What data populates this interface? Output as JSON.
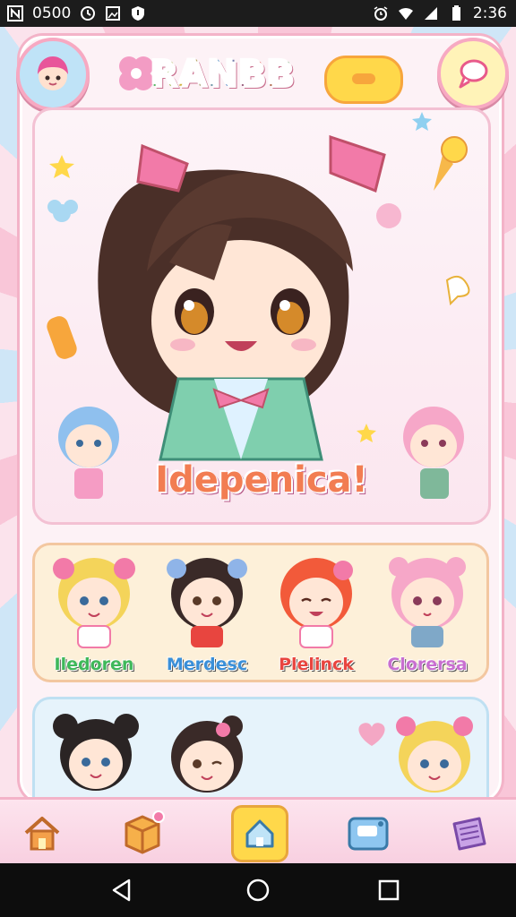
{
  "status_bar": {
    "left_text": "0500",
    "time": "2:36",
    "icons": [
      "notification-n-icon",
      "clock-icon",
      "image-icon",
      "shield-icon",
      "alarm-icon",
      "wifi-icon",
      "signal-icon",
      "battery-icon"
    ]
  },
  "header": {
    "logo_text": "RANBB",
    "avatar_icon": "girl-avatar-icon",
    "chat_icon": "chat-bubble-icon"
  },
  "hero": {
    "title": "Idepenica!",
    "main_character": "girl-brown-hair-pink-bows",
    "side_characters": [
      "chibi-blue-hair",
      "chibi-pink-hair"
    ]
  },
  "characters_row1": [
    {
      "name": "Iledoren",
      "color": "#3fb85a",
      "hair": "#f4d45a"
    },
    {
      "name": "Merdesc",
      "color": "#3a8fd8",
      "hair": "#3a2a28"
    },
    {
      "name": "Plelinck",
      "color": "#e8453f",
      "hair": "#f25a3a"
    },
    {
      "name": "Clorersa",
      "color": "#c86fd0",
      "hair": "#f6a7c8"
    }
  ],
  "characters_row2": [
    {
      "hair": "#2a2424"
    },
    {
      "hair": "#3a2a28"
    },
    {
      "hair": "#f4d45a"
    }
  ],
  "bottom_nav": [
    {
      "icon": "home-icon",
      "color": "#e8944a"
    },
    {
      "icon": "gift-box-icon",
      "color": "#f3a13a"
    },
    {
      "icon": "house-active-icon",
      "color": "#ffd84a"
    },
    {
      "icon": "camera-icon",
      "color": "#6fb6ec"
    },
    {
      "icon": "notes-icon",
      "color": "#b98ad8"
    }
  ],
  "system_nav": [
    "back-icon",
    "home-circle-icon",
    "recents-icon"
  ]
}
